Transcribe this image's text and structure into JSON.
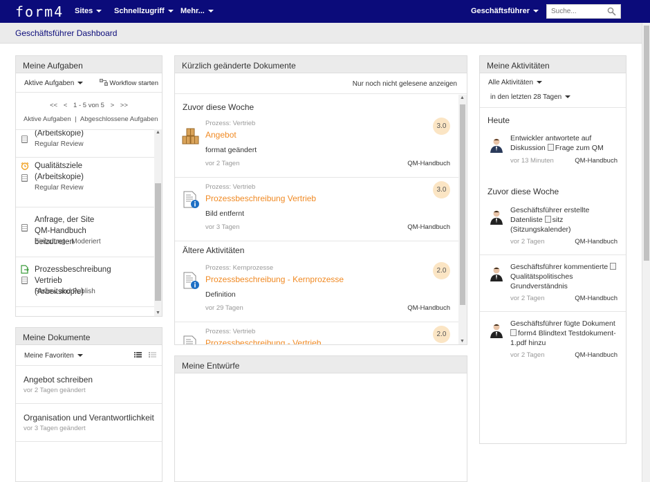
{
  "app": {
    "logo": "form4",
    "nav": [
      "Sites",
      "Schnellzugriff",
      "Mehr..."
    ],
    "user": "Geschäftsführer",
    "search_placeholder": "Suche..."
  },
  "page": {
    "title": "Geschäftsführer Dashboard"
  },
  "tasks": {
    "title": "Meine Aufgaben",
    "filter": "Aktive Aufgaben",
    "workflow_label": "Workflow starten",
    "pager": {
      "first": "<<",
      "prev": "<",
      "range": "1 - 5 von 5",
      "next": ">",
      "last": ">>"
    },
    "tab_active": "Aktive Aufgaben",
    "tab_sep": "|",
    "tab_done": "Abgeschlossene Aufgaben",
    "items": [
      {
        "title": "(Arbeitskopie)",
        "subtitle": "Regular Review",
        "icon": "clipboard-icon"
      },
      {
        "title": "Qualitätsziele (Arbeitskopie)",
        "subtitle": "Regular Review",
        "icon": "alarm-clock-icon"
      },
      {
        "title": "Anfrage, der Site QM-Handbuch beizutreten",
        "subtitle": "Einladung - Moderiert",
        "icon": "clipboard-icon"
      },
      {
        "title": "Prozessbeschreibung Vertrieb (Arbeitskopie)",
        "subtitle": "Review and Publish",
        "icon": "doc-arrow-icon"
      }
    ]
  },
  "documents": {
    "title": "Meine Dokumente",
    "filter": "Meine Favoriten",
    "items": [
      {
        "title": "Angebot schreiben",
        "subtitle": "vor 2 Tagen geändert"
      },
      {
        "title": "Organisation und Verantwortlichkeit",
        "subtitle": "vor 3 Tagen geändert"
      }
    ]
  },
  "recent": {
    "title": "Kürzlich geänderte Dokumente",
    "unread_label": "Nur noch nicht gelesene anzeigen",
    "group_week": "Zuvor diese Woche",
    "group_older": "Ältere Aktivitäten",
    "items": [
      {
        "category": "Prozess: Vertrieb",
        "title": "Angebot",
        "desc": "format geändert",
        "date": "vor 2 Tagen",
        "source": "QM-Handbuch",
        "version": "3.0",
        "icon": "boxes-icon"
      },
      {
        "category": "Prozess: Vertrieb",
        "title": "Prozessbeschreibung Vertrieb",
        "desc": "Bild entfernt",
        "date": "vor 3 Tagen",
        "source": "QM-Handbuch",
        "version": "3.0",
        "icon": "doc-info-icon"
      },
      {
        "category": "Prozess: Kernprozesse",
        "title": "Prozessbeschreibung - Kernprozesse",
        "desc": "Definition",
        "date": "vor 29 Tagen",
        "source": "QM-Handbuch",
        "version": "2.0",
        "icon": "doc-info-icon"
      },
      {
        "category": "Prozess: Vertrieb",
        "title": "Prozessbeschreibung - Vertrieb",
        "desc": "",
        "date": "",
        "source": "",
        "version": "2.0",
        "icon": "doc-info-icon"
      }
    ]
  },
  "drafts": {
    "title": "Meine Entwürfe"
  },
  "activities": {
    "title": "Meine Aktivitäten",
    "filter_type": "Alle Aktivitäten",
    "filter_range": "in den letzten 28 Tagen",
    "group_today": "Heute",
    "group_week": "Zuvor diese Woche",
    "items": [
      {
        "pre": "Entwickler antwortete auf Diskussion ",
        "obj": "Frage zum QM",
        "post": "",
        "date": "vor 13 Minuten",
        "source": "QM-Handbuch"
      },
      {
        "pre": "Geschäftsführer erstellte Datenliste ",
        "obj": "sitz (Sitzungskalender)",
        "post": "",
        "date": "vor 2 Tagen",
        "source": "QM-Handbuch"
      },
      {
        "pre": "Geschäftsführer kommentierte ",
        "obj": "Qualitätspolitisches Grundverständnis",
        "post": "",
        "date": "vor 2 Tagen",
        "source": "QM-Handbuch"
      },
      {
        "pre": "Geschäftsführer fügte Dokument ",
        "obj": "form4 Blindtext Testdokument-1.pdf",
        "post": " hinzu",
        "date": "vor 2 Tagen",
        "source": "QM-Handbuch"
      }
    ]
  },
  "colors": {
    "nav_bg": "#0b0b7a",
    "accent": "#f08a24",
    "badge_bg": "#fbe5c4"
  }
}
